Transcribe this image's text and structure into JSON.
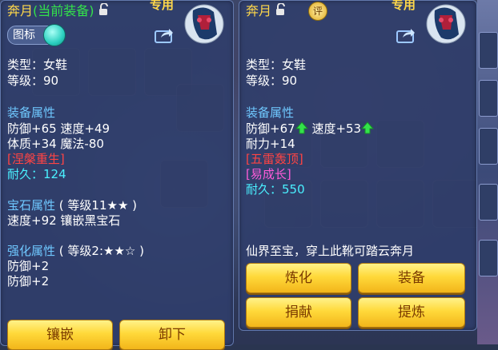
{
  "colors": {
    "attr_heading": "#6fc8ff",
    "up_arrow": "#33e24a",
    "button_text": "#7a3a00"
  },
  "left": {
    "name": "奔月",
    "current_tag": "(当前装备)",
    "exclusive": "专用",
    "toggle_label": "图标",
    "type_line": "类型：女鞋",
    "level_line": "等级：90",
    "attr_heading": "装备属性",
    "attr1": "防御+65 速度+49",
    "attr2": "体质+34 魔法-80",
    "effect": "[涅槃重生]",
    "durability": "耐久：124",
    "gem_heading": "宝石属性",
    "gem_level": "( 等级11★★ )",
    "gem_line": "速度+92 镶嵌黑宝石",
    "enh_heading": "强化属性",
    "enh_level": "( 等级2:★★☆ )",
    "enh1": "防御+2",
    "enh2": "防御+2",
    "buttons": [
      "镶嵌",
      "卸下"
    ]
  },
  "right": {
    "name": "奔月",
    "exclusive": "专用",
    "appraise_badge": "评",
    "type_line": "类型：女鞋",
    "level_line": "等级：90",
    "attr_heading": "装备属性",
    "attr1a": "防御+67",
    "attr1b": "速度+53",
    "attr2": "耐力+14",
    "effect1": "[五雷轰顶]",
    "effect2": "[易成长]",
    "durability": "耐久：550",
    "desc": "仙界至宝，穿上此靴可踏云奔月",
    "buttons": [
      "炼化",
      "装备",
      "捐献",
      "提炼"
    ]
  }
}
